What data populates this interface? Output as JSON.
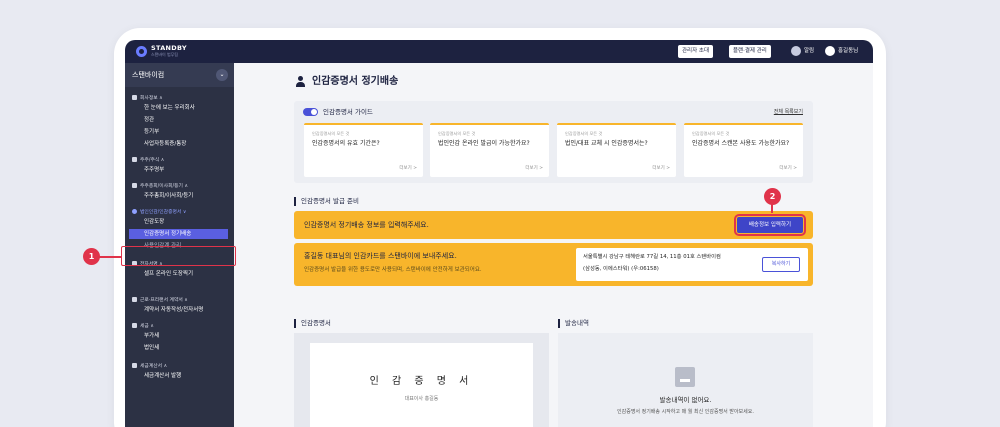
{
  "topbar": {
    "logo_text": "STANDBY",
    "logo_sub": "스탠바이 법무팀",
    "invite_label": "관리자 초대",
    "billing_label": "플랜·결제 관리",
    "alarm_label": "알림",
    "user_label": "홍길동님"
  },
  "sidebar": {
    "company": "스탠바이컴",
    "groups": [
      {
        "label": "회사정보 ∧",
        "items": [
          "한 눈에 보는 우리회사",
          "정관",
          "등기부",
          "사업자등록증/통장"
        ]
      },
      {
        "label": "주주/주식 ∧",
        "items": [
          "주주명부"
        ]
      },
      {
        "label": "주주총회/이사회/등기 ∧",
        "items": [
          "주주총회/이사회/등기"
        ]
      },
      {
        "label": "법인인감/인감증명서 ∨",
        "items": [
          "인감도장",
          "인감증명서 정기배송",
          "사용인감계 관리"
        ]
      },
      {
        "label": "전자서명 ∧",
        "items": [
          "셀프 온라인 도장찍기"
        ]
      },
      {
        "label": "근로·프리랜서 계약서 ∧",
        "items": [
          "계약서 자동작성/전자서명"
        ]
      },
      {
        "label": "세금 ∧",
        "items": [
          "부가세",
          "법인세"
        ]
      },
      {
        "label": "세금계산서 ∧",
        "items": [
          "세금계산서 발행"
        ]
      }
    ]
  },
  "main": {
    "page_title": "인감증명서 정기배송",
    "guide": {
      "title": "인감증명서 가이드",
      "view_all": "전체 목록보기",
      "cards": [
        {
          "category": "인감증명서의 모든 것",
          "question": "인감증명서의 유효 기간은?",
          "more": "더보기 >"
        },
        {
          "category": "인감증명서의 모든 것",
          "question": "법인인감 온라인 발급이 가능한가요?",
          "more": "더보기 >"
        },
        {
          "category": "인감증명서의 모든 것",
          "question": "법인/대표 교체 시 인감증명서는?",
          "more": "더보기 >"
        },
        {
          "category": "인감증명서의 모든 것",
          "question": "인감증명서 스캔본 사용도 가능한가요?",
          "more": "더보기 >"
        }
      ]
    },
    "prep_title": "인감증명서 발급 준비",
    "banner1_text": "인감증명서 정기배송 정보를 입력해주세요.",
    "banner1_button": "배송정보 입력하기",
    "banner2_title": "홍길동 대표님의 인감카드를 스탠바이에 보내주세요.",
    "banner2_sub": "인감증명서 발급을 위한 용도로만 사용되며, 스탠바이에 안전하게 보관되어요.",
    "address_line1": "서울특별시 강남구 테헤란로 77길 14, 11층 01호 스탠바이컴",
    "address_line2": "(삼성동, 이에스타워) (우:06158)",
    "copy_button": "복사하기",
    "cert_section": "인감증명서",
    "ship_section": "발송내역",
    "cert_title": "인 감 증 명 서",
    "cert_sub": "대표이사 홍길동",
    "ship_empty": "발송내역이 없어요.",
    "ship_desc": "인감증명서 정기배송 시작하고 매 월 최신 인감증명서 받아보세요."
  },
  "annotations": {
    "badge1": "1",
    "badge2": "2"
  },
  "colors": {
    "accent": "#4a52d8",
    "banner": "#f8b52b",
    "navy": "#1d2240",
    "highlight": "#e0334a"
  }
}
